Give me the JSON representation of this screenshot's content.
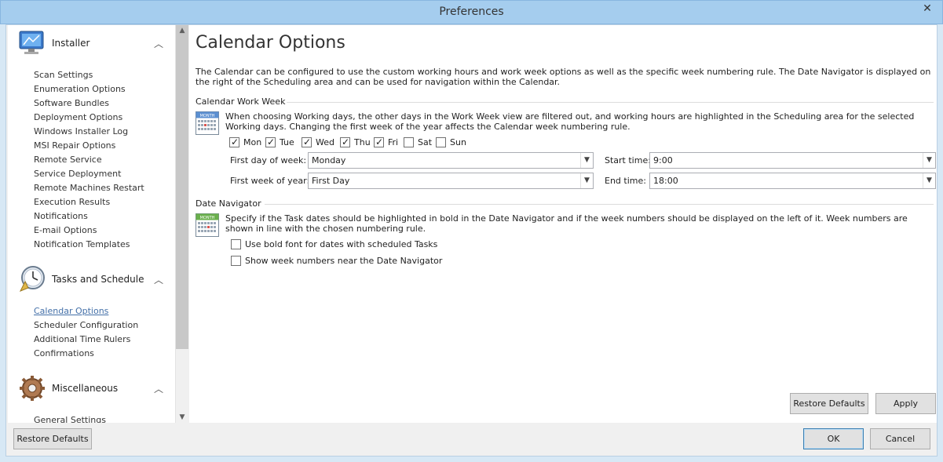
{
  "window": {
    "title": "Preferences",
    "close_glyph": "✕"
  },
  "sidebar": {
    "groups": [
      {
        "label": "Installer",
        "icon": "monitor-icon",
        "items": [
          "Scan Settings",
          "Enumeration Options",
          "Software Bundles",
          "Deployment Options",
          "Windows Installer Log",
          "MSI Repair Options",
          "Remote Service",
          "Service Deployment",
          "Remote Machines Restart",
          "Execution Results",
          "Notifications",
          "E-mail Options",
          "Notification Templates"
        ]
      },
      {
        "label": "Tasks and Schedule",
        "icon": "clock-icon",
        "items": [
          "Calendar Options",
          "Scheduler Configuration",
          "Additional Time Rulers",
          "Confirmations"
        ]
      },
      {
        "label": "Miscellaneous",
        "icon": "gear-icon",
        "items": [
          "General Settings"
        ]
      }
    ],
    "active_item": "Calendar Options",
    "chevron": "︿"
  },
  "main": {
    "title": "Calendar Options",
    "description": "The Calendar can be configured to use the custom working hours and work week options as well as the specific week numbering rule. The Date Navigator is displayed on the right of the Scheduling area and can be used for navigation within the Calendar.",
    "work_week": {
      "section_title": "Calendar Work Week",
      "icon_label": "MONTH",
      "description": "When choosing Working days, the other days in the Work Week view are filtered out, and working hours are highlighted in the Scheduling area for the selected Working days. Changing the first week of the year affects the Calendar week numbering rule.",
      "days": [
        {
          "label": "Mon",
          "checked": true
        },
        {
          "label": "Tue",
          "checked": true
        },
        {
          "label": "Wed",
          "checked": true
        },
        {
          "label": "Thu",
          "checked": true
        },
        {
          "label": "Fri",
          "checked": true
        },
        {
          "label": "Sat",
          "checked": false
        },
        {
          "label": "Sun",
          "checked": false
        }
      ],
      "first_day_label": "First day of week:",
      "first_day_value": "Monday",
      "first_week_label": "First week of year:",
      "first_week_value": "First Day",
      "start_time_label": "Start time:",
      "start_time_value": "9:00",
      "end_time_label": "End time:",
      "end_time_value": "18:00"
    },
    "date_navigator": {
      "section_title": "Date Navigator",
      "icon_label": "MONTH",
      "description": "Specify if the Task dates should be highlighted in bold in the Date Navigator and if the week numbers should be displayed on the left of it. Week numbers are shown in line with the chosen numbering rule.",
      "options": [
        {
          "label": "Use bold font for dates with scheduled Tasks",
          "checked": false
        },
        {
          "label": "Show week numbers near the Date Navigator",
          "checked": false
        }
      ]
    },
    "restore_defaults_label": "Restore Defaults",
    "apply_label": "Apply"
  },
  "footer": {
    "restore_defaults_label": "Restore Defaults",
    "ok_label": "OK",
    "cancel_label": "Cancel"
  },
  "colors": {
    "accent": "#4470a8",
    "titlebar": "#a5cdee",
    "calendar_blue": "#5b8fd1",
    "calendar_green": "#6ab04c"
  }
}
